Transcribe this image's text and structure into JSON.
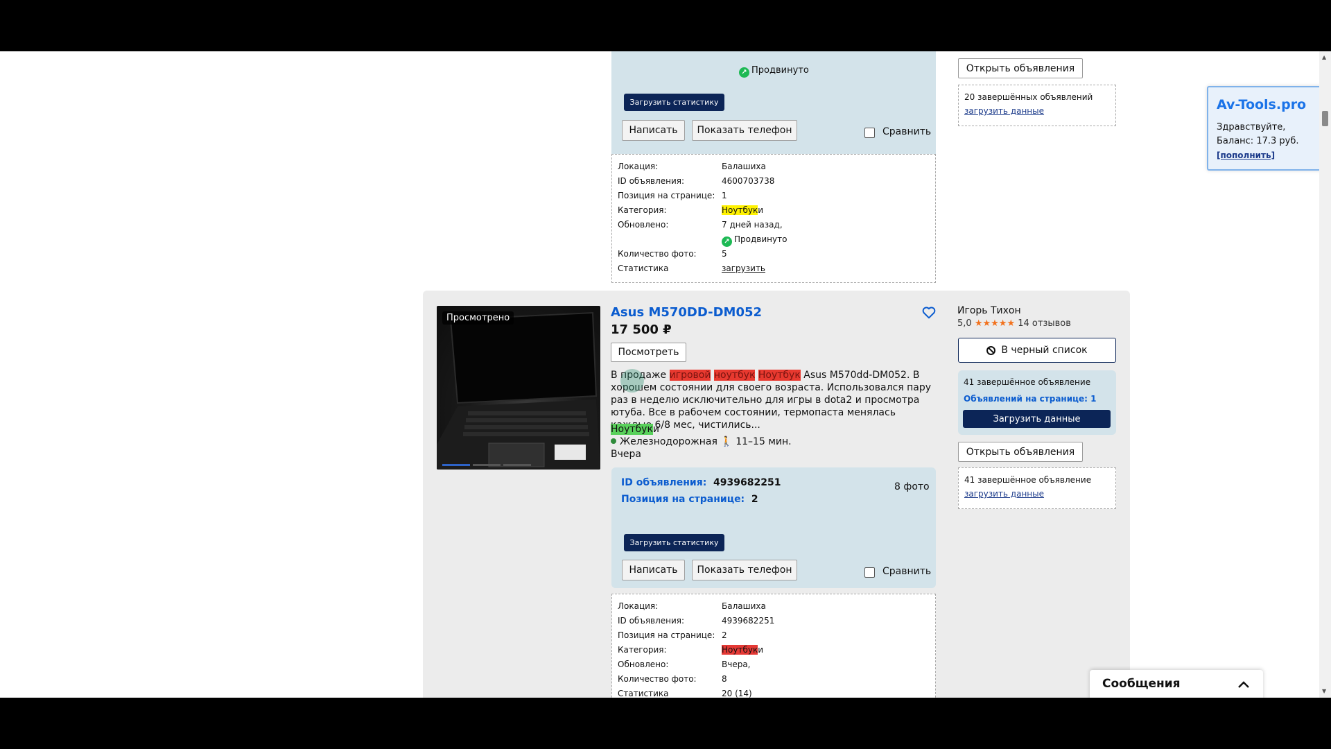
{
  "top_card": {
    "promo_label": "Продвинуто",
    "load_stats_button": "Загрузить статистику",
    "write_button": "Написать",
    "show_phone_button": "Показать телефон",
    "compare_label": "Сравнить",
    "details": {
      "location_label": "Локация:",
      "location_value": "Балашиха",
      "id_label": "ID объявления:",
      "id_value": "4600703738",
      "position_label": "Позиция на странице:",
      "position_value": "1",
      "category_label": "Категория:",
      "category_highlight": "Ноутбук",
      "category_rest": "и",
      "updated_label": "Обновлено:",
      "updated_value": "7 дней назад,",
      "updated_promo": "Продвинуто",
      "photos_label": "Количество фото:",
      "photos_value": "5",
      "stats_label": "Статистика",
      "stats_link": "загрузить"
    },
    "seller": {
      "open_ads_button": "Открыть объявления",
      "completed_text": "20 завершённых объявлений",
      "load_data_link": "загрузить данные"
    }
  },
  "listing": {
    "viewed_badge": "Просмотрено",
    "title": "Asus M570DD-DM052",
    "price": "17 500 ₽",
    "view_button": "Посмотреть",
    "desc": {
      "part1": "В продаже ",
      "hl1": "игровой",
      "hl2": "ноутбук",
      "hl3": "Ноутбук",
      "part2": " Asus M570dd-DM052. В хорошем состоянии для своего возраста. Использовался пару раз в неделю исключительно для игры в dota2 и просмотра ютуба. Все в рабочем состоянии, термопаста менялась каждые 6/8 мес, чистились..."
    },
    "category_highlight": "Ноутбук",
    "category_rest": "и",
    "metro": "Железнодорожная",
    "walk_time": "11–15 мин.",
    "date": "Вчера",
    "panel": {
      "id_label": "ID объявления:",
      "id_value": "4939682251",
      "position_label": "Позиция на странице:",
      "position_value": "2",
      "photos": "8 фото",
      "load_stats_button": "Загрузить статистику",
      "write_button": "Написать",
      "show_phone_button": "Показать телефон",
      "compare_label": "Сравнить"
    },
    "details": {
      "location_label": "Локация:",
      "location_value": "Балашиха",
      "id_label": "ID объявления:",
      "id_value": "4939682251",
      "position_label": "Позиция на странице:",
      "position_value": "2",
      "category_label": "Категория:",
      "category_highlight": "Ноутбук",
      "category_rest": "и",
      "updated_label": "Обновлено:",
      "updated_value": "Вчера,",
      "photos_label": "Количество фото:",
      "photos_value": "8",
      "stats_label": "Статистика",
      "stats_value": "20 (14)"
    },
    "seller": {
      "name": "Игорь Тихон",
      "rating": "5,0",
      "stars": "★★★★★",
      "reviews": "14 отзывов",
      "blacklist_button": "В черный список",
      "completed_text": "41 завершённое объявление",
      "per_page_text": "Объявлений на странице: 1",
      "load_data_button": "Загрузить данные",
      "open_ads_button": "Открыть объявления",
      "completed_text2": "41 завершённое объявление",
      "load_data_link": "загрузить данные"
    }
  },
  "avtools": {
    "title": "Av-Tools.pro",
    "greeting": "Здравствуйте,",
    "balance": "Баланс: 17.3 руб.",
    "topup_link": "[пополнить]"
  },
  "messages": {
    "label": "Сообщения"
  },
  "colors": {
    "accent_blue": "#0b5ccf",
    "dark_navy": "#0c2557",
    "panel_blue": "#d3e3ea",
    "promo_green": "#1db954"
  }
}
